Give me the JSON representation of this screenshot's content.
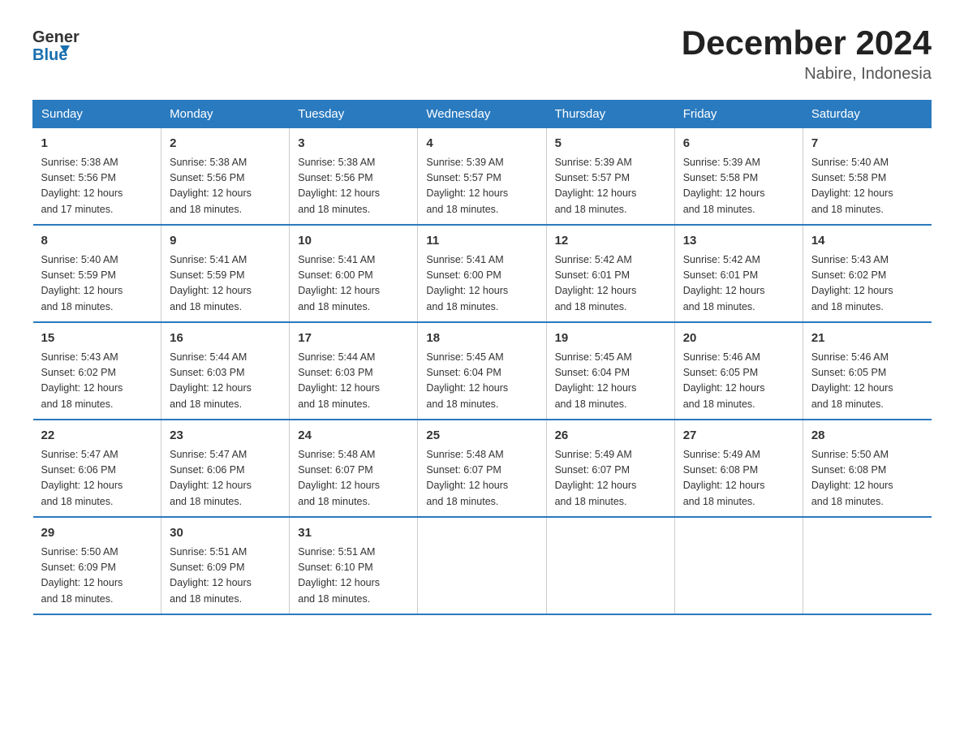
{
  "header": {
    "logo": {
      "text1": "General",
      "text2": "Blue"
    },
    "title": "December 2024",
    "location": "Nabire, Indonesia"
  },
  "days_of_week": [
    "Sunday",
    "Monday",
    "Tuesday",
    "Wednesday",
    "Thursday",
    "Friday",
    "Saturday"
  ],
  "weeks": [
    [
      {
        "day": "1",
        "info": "Sunrise: 5:38 AM\nSunset: 5:56 PM\nDaylight: 12 hours\nand 17 minutes."
      },
      {
        "day": "2",
        "info": "Sunrise: 5:38 AM\nSunset: 5:56 PM\nDaylight: 12 hours\nand 18 minutes."
      },
      {
        "day": "3",
        "info": "Sunrise: 5:38 AM\nSunset: 5:56 PM\nDaylight: 12 hours\nand 18 minutes."
      },
      {
        "day": "4",
        "info": "Sunrise: 5:39 AM\nSunset: 5:57 PM\nDaylight: 12 hours\nand 18 minutes."
      },
      {
        "day": "5",
        "info": "Sunrise: 5:39 AM\nSunset: 5:57 PM\nDaylight: 12 hours\nand 18 minutes."
      },
      {
        "day": "6",
        "info": "Sunrise: 5:39 AM\nSunset: 5:58 PM\nDaylight: 12 hours\nand 18 minutes."
      },
      {
        "day": "7",
        "info": "Sunrise: 5:40 AM\nSunset: 5:58 PM\nDaylight: 12 hours\nand 18 minutes."
      }
    ],
    [
      {
        "day": "8",
        "info": "Sunrise: 5:40 AM\nSunset: 5:59 PM\nDaylight: 12 hours\nand 18 minutes."
      },
      {
        "day": "9",
        "info": "Sunrise: 5:41 AM\nSunset: 5:59 PM\nDaylight: 12 hours\nand 18 minutes."
      },
      {
        "day": "10",
        "info": "Sunrise: 5:41 AM\nSunset: 6:00 PM\nDaylight: 12 hours\nand 18 minutes."
      },
      {
        "day": "11",
        "info": "Sunrise: 5:41 AM\nSunset: 6:00 PM\nDaylight: 12 hours\nand 18 minutes."
      },
      {
        "day": "12",
        "info": "Sunrise: 5:42 AM\nSunset: 6:01 PM\nDaylight: 12 hours\nand 18 minutes."
      },
      {
        "day": "13",
        "info": "Sunrise: 5:42 AM\nSunset: 6:01 PM\nDaylight: 12 hours\nand 18 minutes."
      },
      {
        "day": "14",
        "info": "Sunrise: 5:43 AM\nSunset: 6:02 PM\nDaylight: 12 hours\nand 18 minutes."
      }
    ],
    [
      {
        "day": "15",
        "info": "Sunrise: 5:43 AM\nSunset: 6:02 PM\nDaylight: 12 hours\nand 18 minutes."
      },
      {
        "day": "16",
        "info": "Sunrise: 5:44 AM\nSunset: 6:03 PM\nDaylight: 12 hours\nand 18 minutes."
      },
      {
        "day": "17",
        "info": "Sunrise: 5:44 AM\nSunset: 6:03 PM\nDaylight: 12 hours\nand 18 minutes."
      },
      {
        "day": "18",
        "info": "Sunrise: 5:45 AM\nSunset: 6:04 PM\nDaylight: 12 hours\nand 18 minutes."
      },
      {
        "day": "19",
        "info": "Sunrise: 5:45 AM\nSunset: 6:04 PM\nDaylight: 12 hours\nand 18 minutes."
      },
      {
        "day": "20",
        "info": "Sunrise: 5:46 AM\nSunset: 6:05 PM\nDaylight: 12 hours\nand 18 minutes."
      },
      {
        "day": "21",
        "info": "Sunrise: 5:46 AM\nSunset: 6:05 PM\nDaylight: 12 hours\nand 18 minutes."
      }
    ],
    [
      {
        "day": "22",
        "info": "Sunrise: 5:47 AM\nSunset: 6:06 PM\nDaylight: 12 hours\nand 18 minutes."
      },
      {
        "day": "23",
        "info": "Sunrise: 5:47 AM\nSunset: 6:06 PM\nDaylight: 12 hours\nand 18 minutes."
      },
      {
        "day": "24",
        "info": "Sunrise: 5:48 AM\nSunset: 6:07 PM\nDaylight: 12 hours\nand 18 minutes."
      },
      {
        "day": "25",
        "info": "Sunrise: 5:48 AM\nSunset: 6:07 PM\nDaylight: 12 hours\nand 18 minutes."
      },
      {
        "day": "26",
        "info": "Sunrise: 5:49 AM\nSunset: 6:07 PM\nDaylight: 12 hours\nand 18 minutes."
      },
      {
        "day": "27",
        "info": "Sunrise: 5:49 AM\nSunset: 6:08 PM\nDaylight: 12 hours\nand 18 minutes."
      },
      {
        "day": "28",
        "info": "Sunrise: 5:50 AM\nSunset: 6:08 PM\nDaylight: 12 hours\nand 18 minutes."
      }
    ],
    [
      {
        "day": "29",
        "info": "Sunrise: 5:50 AM\nSunset: 6:09 PM\nDaylight: 12 hours\nand 18 minutes."
      },
      {
        "day": "30",
        "info": "Sunrise: 5:51 AM\nSunset: 6:09 PM\nDaylight: 12 hours\nand 18 minutes."
      },
      {
        "day": "31",
        "info": "Sunrise: 5:51 AM\nSunset: 6:10 PM\nDaylight: 12 hours\nand 18 minutes."
      },
      {
        "day": "",
        "info": ""
      },
      {
        "day": "",
        "info": ""
      },
      {
        "day": "",
        "info": ""
      },
      {
        "day": "",
        "info": ""
      }
    ]
  ]
}
